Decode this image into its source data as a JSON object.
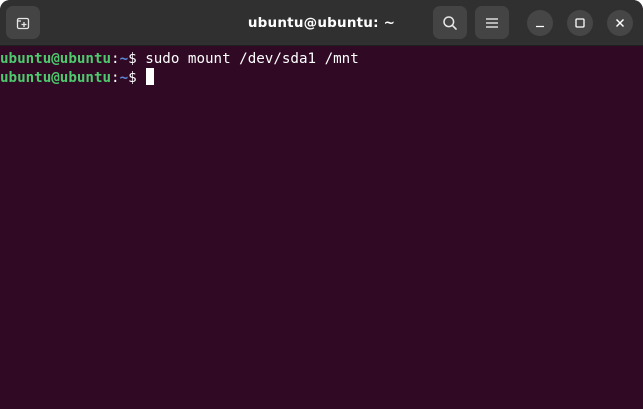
{
  "window": {
    "title": "ubuntu@ubuntu: ~"
  },
  "icons": {
    "new_tab": "new-tab-icon",
    "search": "search-icon",
    "menu": "hamburger-menu-icon",
    "minimize": "minimize-icon",
    "maximize": "maximize-icon",
    "close": "close-icon"
  },
  "terminal": {
    "lines": [
      {
        "userhost": "ubuntu@ubuntu",
        "colon": ":",
        "path": "~",
        "symbol": "$",
        "command": " sudo mount /dev/sda1 /mnt"
      },
      {
        "userhost": "ubuntu@ubuntu",
        "colon": ":",
        "path": "~",
        "symbol": "$",
        "command": " "
      }
    ]
  },
  "colors": {
    "background": "#300a24",
    "titlebar": "#303030",
    "prompt_user": "#4ec96e",
    "prompt_path": "#5f87d7",
    "text": "#ffffff"
  }
}
